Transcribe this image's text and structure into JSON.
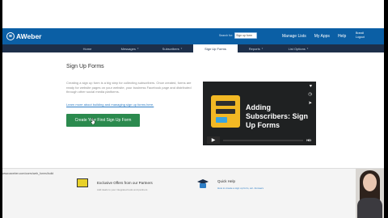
{
  "app": {
    "logo_text": "AWeber",
    "search_label": "Search for:",
    "search_value": "Sign up form",
    "top_nav": [
      "Manage Lists",
      "My Apps",
      "Help"
    ],
    "user_line1": "Brandi",
    "user_line2": "Logout"
  },
  "nav": {
    "tabs": [
      {
        "label": "Home",
        "active": false
      },
      {
        "label": "Messages",
        "active": false
      },
      {
        "label": "Subscribers",
        "active": false
      },
      {
        "label": "Sign Up Forms",
        "active": true
      },
      {
        "label": "Reports",
        "active": false
      },
      {
        "label": "List Options",
        "active": false
      }
    ]
  },
  "main": {
    "title": "Sign Up Forms",
    "description": "Creating a sign up form is a big step for collecting subscribers. Once created, forms are ready for website pages on your website, your business Facebook page and distributed through other social media platforms.",
    "learn_link": "Learn more about building and managing sign up forms here.",
    "cta_label": "Create Your First Sign Up Form"
  },
  "video": {
    "title": "Adding Subscribers: Sign Up Forms",
    "hd_label": "HD",
    "heart_icon": "heart-icon",
    "clock_icon": "clock-icon",
    "share_icon": "share-icon"
  },
  "footer": {
    "status_url": "www.aweber.com/users/web_forms/build",
    "offers_title": "Exclusive Offers from our Partners",
    "offers_sub": "Add deals to your integrated tools and partners",
    "help_title": "Quick Help",
    "help_sub": "How to create a sign up form, etc. Answers"
  },
  "colors": {
    "brand_blue": "#0b5fa5",
    "nav_dark": "#1d2f4a",
    "cta_green": "#2b8a4e",
    "link_blue": "#2d7dc5"
  }
}
